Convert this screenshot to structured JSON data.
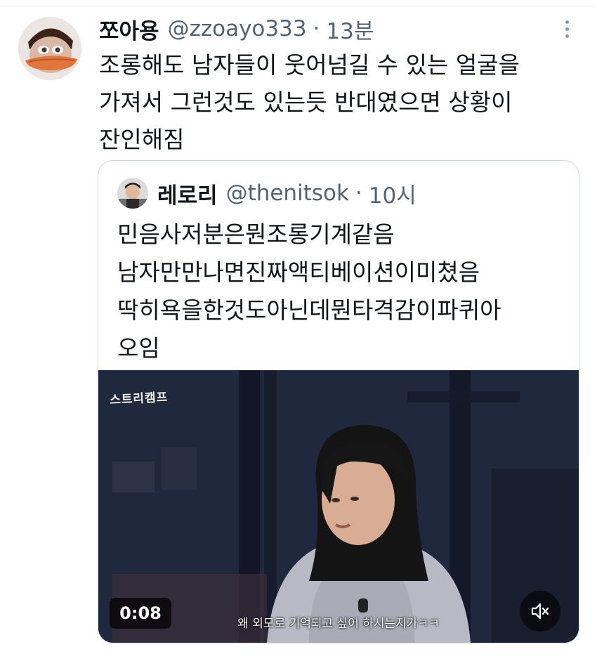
{
  "tweet": {
    "display_name": "쪼아용",
    "handle": "@zzoayo333",
    "separator": "·",
    "time": "13분",
    "text_lines": [
      "조롱해도 남자들이 웃어넘길 수 있는 얼굴을",
      "가져서 그런것도 있는듯 반대였으면 상황이",
      "잔인해짐"
    ]
  },
  "quote": {
    "display_name": "레로리",
    "handle": "@thenitsok",
    "separator": "·",
    "time": "10시",
    "text_lines": [
      "민음사저분은뭔조롱기계같음",
      "남자만만나면진짜액티베이션이미쳤음",
      "딱히욕을한것도아닌데뭔타격감이파퀴아",
      "오임"
    ],
    "video": {
      "watermark": "스트리캠프",
      "duration": "0:08",
      "subtitle": "왜 외모로 기억되고 싶어 하시는지가ㅋㅋ"
    }
  },
  "icons": {
    "more": "more-vertical-icon",
    "volume": "speaker-muted-icon"
  }
}
